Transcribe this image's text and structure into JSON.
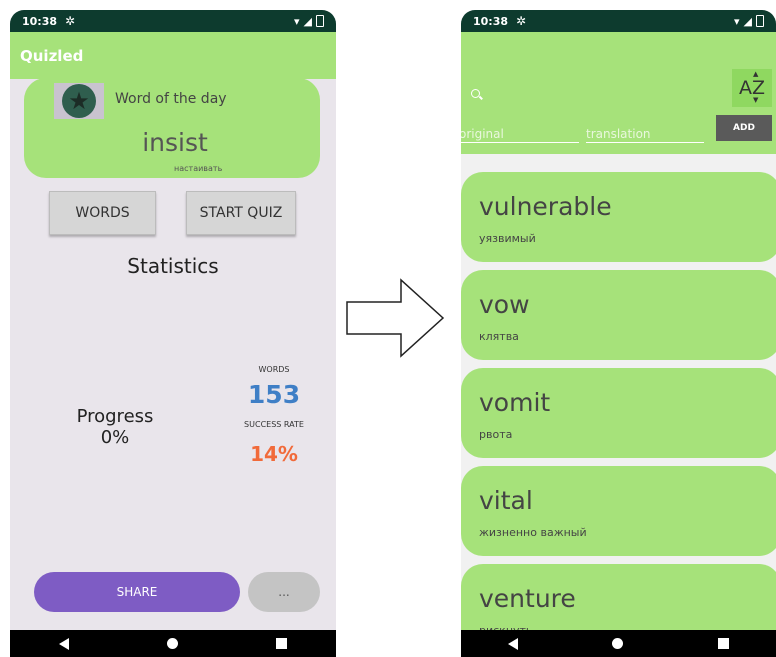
{
  "status": {
    "time": "10:38"
  },
  "home": {
    "app_title": "Quizled",
    "word_of_day_label": "Word of the day",
    "word": "insist",
    "translation": "настаивать",
    "words_button": "WORDS",
    "quiz_button": "START QUIZ",
    "stats_title": "Statistics",
    "progress_label": "Progress",
    "progress_value": "0%",
    "words_caption": "WORDS",
    "words_count": "153",
    "rate_caption": "SUCCESS RATE",
    "rate_value": "14%",
    "share_button": "SHARE",
    "more_button": "..."
  },
  "words": {
    "sort_button": "AZ",
    "original_placeholder": "original",
    "translation_placeholder": "translation",
    "add_button": "ADD",
    "items": [
      {
        "word": "vulnerable",
        "translation": "уязвимый"
      },
      {
        "word": "vow",
        "translation": "клятва"
      },
      {
        "word": "vomit",
        "translation": "рвота"
      },
      {
        "word": "vital",
        "translation": "жизненно важный"
      },
      {
        "word": "venture",
        "translation": "рискнуть"
      }
    ]
  },
  "colors": {
    "status_bar": "#0d3b2e",
    "app_green": "#a6e27a",
    "share_purple": "#7e5cc4",
    "words_blue": "#3f7fc6",
    "rate_orange": "#f16a3a"
  }
}
